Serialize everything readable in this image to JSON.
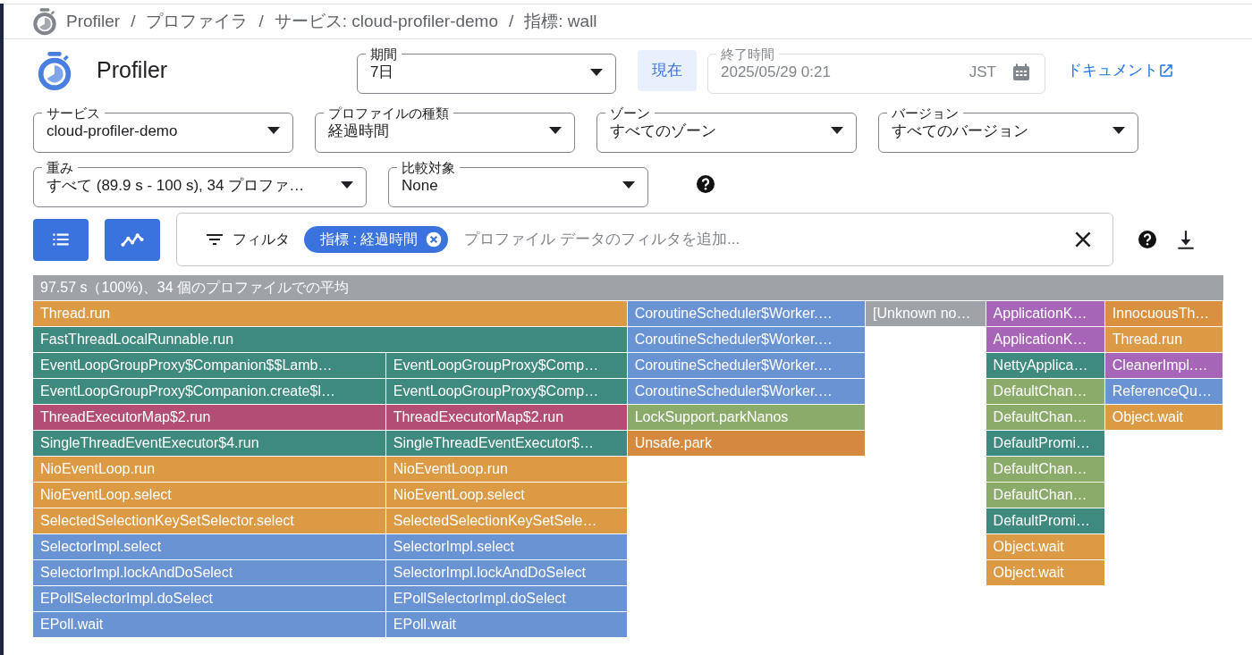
{
  "breadcrumb": [
    {
      "text": "Profiler"
    },
    {
      "text": "/"
    },
    {
      "text": "プロファイラ"
    },
    {
      "text": "/"
    },
    {
      "text": "サービス: cloud-profiler-demo"
    },
    {
      "text": "/"
    },
    {
      "text": "指標: wall"
    }
  ],
  "app_title": "Profiler",
  "period": {
    "label": "期間",
    "value": "7日"
  },
  "now_button": "現在",
  "end_time": {
    "label": "終了時間",
    "value": "2025/05/29 0:21",
    "timezone": "JST",
    "disabled": true
  },
  "docs_link": "ドキュメント",
  "select_rows": [
    [
      {
        "label": "サービス",
        "value": "cloud-profiler-demo"
      },
      {
        "label": "プロファイルの種類",
        "value": "経過時間"
      },
      {
        "label": "ゾーン",
        "value": "すべてのゾーン"
      },
      {
        "label": "バージョン",
        "value": "すべてのバージョン"
      }
    ],
    [
      {
        "label": "重み",
        "value": "すべて (89.9 s - 100 s), 34 プロファ…"
      },
      {
        "label": "比較対象",
        "value": "None"
      }
    ]
  ],
  "filter": {
    "label": "フィルタ",
    "chips": [
      {
        "text": "指標 : 経過時間"
      }
    ],
    "placeholder": "プロファイル データのフィルタを追加..."
  },
  "flame_graph": {
    "root": {
      "label": "97.57 s（100%)、34 個のプロファイルでの平均",
      "color": "#9ea3a8",
      "children": [
        {
          "label": "Thread.run",
          "color": "#dc9a45",
          "children": [
            {
              "label": "FastThreadLocalRunnable.run",
              "color": "#3f8a7f",
              "children": [
                {
                  "label": "EventLoopGroupProxy$Companion$$Lamb…",
                  "color": "#3f8a7f",
                  "children": [
                    {
                      "label": "EventLoopGroupProxy$Companion.create$l…",
                      "color": "#3f8a7f",
                      "children": [
                        {
                          "label": "ThreadExecutorMap$2.run",
                          "color": "#b34d73",
                          "children": [
                            {
                              "label": "SingleThreadEventExecutor$4.run",
                              "color": "#3f8a7f",
                              "children": [
                                {
                                  "label": "NioEventLoop.run",
                                  "color": "#dc9a45",
                                  "children": [
                                    {
                                      "label": "NioEventLoop.select",
                                      "color": "#dc9a45",
                                      "children": [
                                        {
                                          "label": "SelectedSelectionKeySetSelector.select",
                                          "color": "#dc9a45",
                                          "children": [
                                            {
                                              "label": "SelectorImpl.select",
                                              "color": "#6a93d4",
                                              "children": [
                                                {
                                                  "label": "SelectorImpl.lockAndDoSelect",
                                                  "color": "#6a93d4",
                                                  "children": [
                                                    {
                                                      "label": "EPollSelectorImpl.doSelect",
                                                      "color": "#6a93d4",
                                                      "children": [
                                                        {
                                                          "label": "EPoll.wait",
                                                          "color": "#6a93d4"
                                                        }
                                                      ]
                                                    }
                                                  ]
                                                }
                                              ]
                                            }
                                          ]
                                        }
                                      ]
                                    }
                                  ]
                                }
                              ]
                            }
                          ]
                        }
                      ]
                    }
                  ]
                },
                {
                  "label": "EventLoopGroupProxy$Comp…",
                  "color": "#3f8a7f",
                  "children": [
                    {
                      "label": "EventLoopGroupProxy$Comp…",
                      "color": "#3f8a7f",
                      "children": [
                        {
                          "label": "ThreadExecutorMap$2.run",
                          "color": "#b34d73",
                          "children": [
                            {
                              "label": "SingleThreadEventExecutor$…",
                              "color": "#3f8a7f",
                              "children": [
                                {
                                  "label": "NioEventLoop.run",
                                  "color": "#dc9a45",
                                  "children": [
                                    {
                                      "label": "NioEventLoop.select",
                                      "color": "#dc9a45",
                                      "children": [
                                        {
                                          "label": "SelectedSelectionKeySetSele…",
                                          "color": "#dc9a45",
                                          "children": [
                                            {
                                              "label": "SelectorImpl.select",
                                              "color": "#6a93d4",
                                              "children": [
                                                {
                                                  "label": "SelectorImpl.lockAndDoSelect",
                                                  "color": "#6a93d4",
                                                  "children": [
                                                    {
                                                      "label": "EPollSelectorImpl.doSelect",
                                                      "color": "#6a93d4",
                                                      "children": [
                                                        {
                                                          "label": "EPoll.wait",
                                                          "color": "#6a93d4"
                                                        }
                                                      ]
                                                    }
                                                  ]
                                                }
                                              ]
                                            }
                                          ]
                                        }
                                      ]
                                    }
                                  ]
                                }
                              ]
                            }
                          ]
                        }
                      ]
                    }
                  ]
                }
              ]
            }
          ]
        },
        {
          "label": "CoroutineScheduler$Worker.…",
          "color": "#6a93d4",
          "children": [
            {
              "label": "CoroutineScheduler$Worker.…",
              "color": "#6a93d4",
              "children": [
                {
                  "label": "CoroutineScheduler$Worker.…",
                  "color": "#6a93d4",
                  "children": [
                    {
                      "label": "CoroutineScheduler$Worker.…",
                      "color": "#6a93d4",
                      "children": [
                        {
                          "label": "LockSupport.parkNanos",
                          "color": "#8bab6a",
                          "children": [
                            {
                              "label": "Unsafe.park",
                              "color": "#d4893f"
                            }
                          ]
                        }
                      ]
                    }
                  ]
                }
              ]
            }
          ]
        },
        {
          "label": "[Unknown no…",
          "color": "#9ea3a8"
        },
        {
          "label": "ApplicationK…",
          "color": "#a765b8",
          "children": [
            {
              "label": "ApplicationK…",
              "color": "#a765b8",
              "children": [
                {
                  "label": "NettyApplica…",
                  "color": "#3f8a7f",
                  "children": [
                    {
                      "label": "DefaultChan…",
                      "color": "#8bab6a",
                      "children": [
                        {
                          "label": "DefaultChan…",
                          "color": "#8bab6a",
                          "children": [
                            {
                              "label": "DefaultPromi…",
                              "color": "#3f8a7f",
                              "children": [
                                {
                                  "label": "DefaultChan…",
                                  "color": "#8bab6a",
                                  "children": [
                                    {
                                      "label": "DefaultChan…",
                                      "color": "#8bab6a",
                                      "children": [
                                        {
                                          "label": "DefaultPromi…",
                                          "color": "#3f8a7f",
                                          "children": [
                                            {
                                              "label": "Object.wait",
                                              "color": "#dc9a45",
                                              "children": [
                                                {
                                                  "label": "Object.wait",
                                                  "color": "#dc9a45"
                                                }
                                              ]
                                            }
                                          ]
                                        }
                                      ]
                                    }
                                  ]
                                }
                              ]
                            }
                          ]
                        }
                      ]
                    }
                  ]
                }
              ]
            }
          ]
        },
        {
          "label": "InnocuousTh…",
          "color": "#d9913f",
          "children": [
            {
              "label": "Thread.run",
              "color": "#dc9a45",
              "children": [
                {
                  "label": "CleanerImpl.…",
                  "color": "#a765b8",
                  "children": [
                    {
                      "label": "ReferenceQu…",
                      "color": "#6a93d4",
                      "children": [
                        {
                          "label": "Object.wait",
                          "color": "#dc9a45"
                        }
                      ]
                    }
                  ]
                }
              ]
            }
          ]
        }
      ]
    }
  }
}
